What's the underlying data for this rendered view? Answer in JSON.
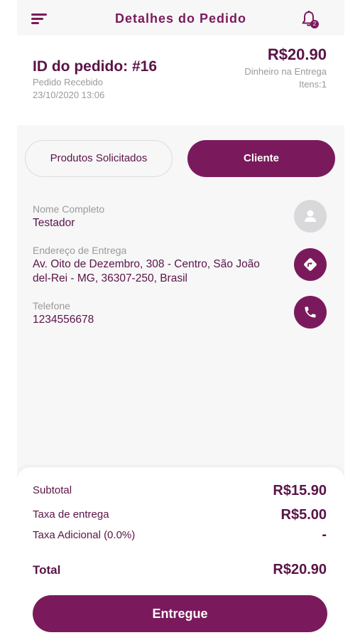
{
  "header": {
    "title": "Detalhes do Pedido",
    "menu_icon": "menu-icon",
    "bell_icon": "bell-icon",
    "notification_count": "2"
  },
  "order": {
    "id_label": "ID do pedido: #16",
    "status": "Pedido Recebido",
    "datetime": "23/10/2020 13:06",
    "total": "R$20.90",
    "payment_method": "Dinheiro na Entrega",
    "items": "Itens:1"
  },
  "tabs": {
    "products": "Produtos Solicitados",
    "client": "Cliente"
  },
  "client": {
    "name_label": "Nome Completo",
    "name": "Testador",
    "address_label": "Endereço de Entrega",
    "address_line1": "Av. Oito de Dezembro, 308 - Centro, São João",
    "address_line2": "del-Rei - MG, 36307-250, Brasil",
    "phone_label": "Telefone",
    "phone": "1234556678"
  },
  "summary": {
    "subtotal_label": "Subtotal",
    "subtotal": "R$15.90",
    "delivery_label": "Taxa de entrega",
    "delivery": "R$5.00",
    "extra_label": "Taxa Adicional (0.0%)",
    "extra": "-",
    "total_label": "Total",
    "total": "R$20.90"
  },
  "actions": {
    "deliver": "Entregue"
  },
  "colors": {
    "primary": "#7a1a5c",
    "text_dark": "#5a1446",
    "muted": "#9a9a9a",
    "background": "#f7f7f8"
  }
}
